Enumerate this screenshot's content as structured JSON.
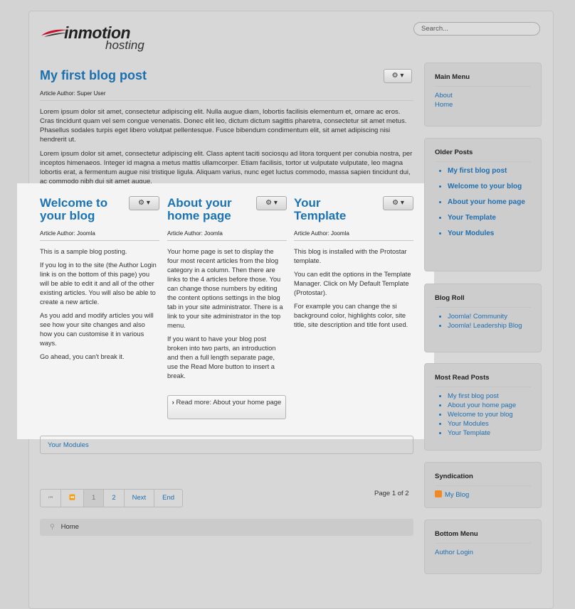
{
  "header": {
    "logo_primary": "inmotion",
    "logo_secondary": "hosting",
    "search_placeholder": "Search..."
  },
  "main_post": {
    "title": "My first blog post",
    "author": "Article Author: Super User",
    "paragraphs": [
      "Lorem ipsum dolor sit amet, consectetur adipiscing elit. Nulla augue diam, lobortis facilisis elementum et, ornare ac eros. Cras tincidunt quam vel sem congue venenatis. Donec elit leo, dictum dictum sagittis pharetra, consectetur sit amet metus. Phasellus sodales turpis eget libero volutpat pellentesque. Fusce bibendum condimentum elit, sit amet adipiscing nisi hendrerit ut.",
      "Lorem ipsum dolor sit amet, consectetur adipiscing elit. Class aptent taciti sociosqu ad litora torquent per conubia nostra, per inceptos himenaeos. Integer id magna a metus mattis ullamcorper. Etiam facilisis, tortor ut vulputate vulputate, leo magna lobortis erat, a fermentum augue nisi tristique ligula. Aliquam varius, nunc eget luctus commodo, massa sapien tincidunt dui, ac commodo nibh dui sit amet augue."
    ]
  },
  "columns": [
    {
      "title_line1": "Welcome to",
      "title_line2": "your blog",
      "author": "Article Author: Joomla",
      "paragraphs": [
        "This is a sample blog posting.",
        "If you log in to the site (the Author Login link is on the bottom of this page) you will be able to edit it and all of the other existing articles. You will also be able to create a new article.",
        "As you add and modify articles you will see how your site changes and also how you can customise it in various ways.",
        "Go ahead, you can't break it."
      ]
    },
    {
      "title_line1": "About your",
      "title_line2": "home page",
      "author": "Article Author: Joomla",
      "paragraphs": [
        "Your home page is set to display the four most recent articles from the blog category in a column. Then there are links to the 4 articles before those. You can change those numbers by editing the content options settings in the blog tab in your site administrator. There is a link to your site administrator in the top menu.",
        "If you want to have your blog post broken into two parts, an introduction and then a full length separate page, use the Read More button to insert a break."
      ],
      "read_more": "Read more: About your home page"
    },
    {
      "title_line1": "Your",
      "title_line2": "Template",
      "author": "Article Author: Joomla",
      "paragraphs": [
        "This blog is installed with the Protostar template.",
        "You can edit the options in the Template Manager. Click on My Default Template (Protostar).",
        "For example you can change the si background color, highlights color, site title, site description and title font used."
      ]
    }
  ],
  "more_links": {
    "item": "Your Modules"
  },
  "pagination": {
    "first": "⏮",
    "prev": "⏪",
    "pages": [
      "1",
      "2"
    ],
    "next": "Next",
    "end": "End",
    "summary": "Page 1 of 2"
  },
  "breadcrumb": {
    "home": "Home"
  },
  "sidebar": {
    "main_menu": {
      "title": "Main Menu",
      "items": [
        "About",
        "Home"
      ]
    },
    "older_posts": {
      "title": "Older Posts",
      "items": [
        "My first blog post",
        "Welcome to your blog",
        "About your home page",
        "Your Template",
        "Your Modules"
      ]
    },
    "blog_roll": {
      "title": "Blog Roll",
      "items": [
        "Joomla! Community",
        "Joomla! Leadership Blog"
      ]
    },
    "most_read": {
      "title": "Most Read Posts",
      "items": [
        "My first blog post",
        "About your home page",
        "Welcome to your blog",
        "Your Modules",
        "Your Template"
      ]
    },
    "syndication": {
      "title": "Syndication",
      "link": "My Blog"
    },
    "bottom_menu": {
      "title": "Bottom Menu",
      "items": [
        "Author Login"
      ]
    }
  },
  "colors": {
    "link": "#1f6fb0",
    "title": "#1a6fae",
    "background": "#d3d3d3",
    "highlight": "#f4f4f4"
  }
}
